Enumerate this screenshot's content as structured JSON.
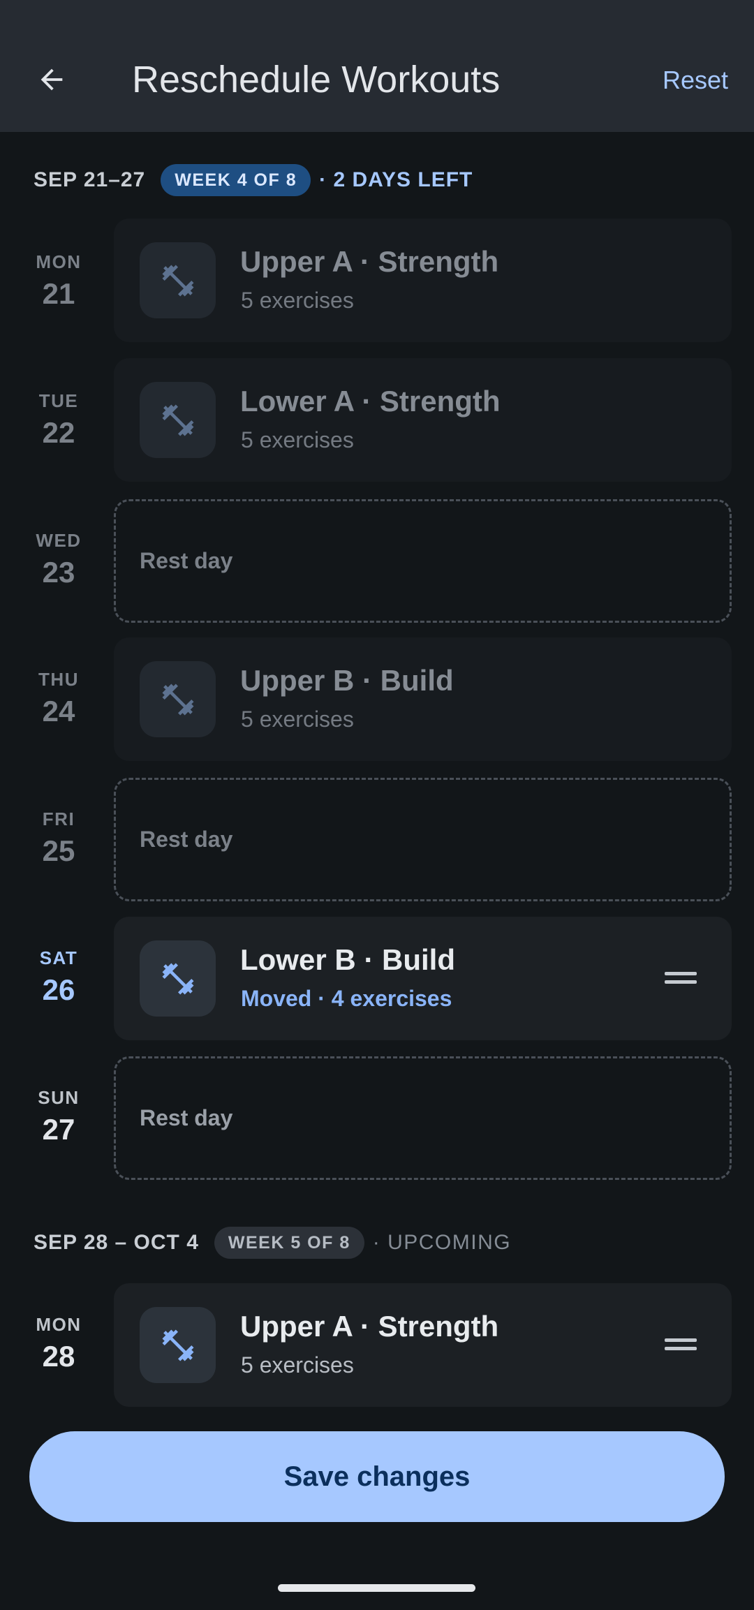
{
  "header": {
    "title": "Reschedule Workouts",
    "reset_label": "Reset",
    "back_icon": "arrow-left-icon"
  },
  "weeks": [
    {
      "range": "SEP 21–27",
      "pill": "WEEK 4 OF 8",
      "status": "· 2 DAYS LEFT",
      "days": [
        {
          "day": "MON",
          "date": "21",
          "kind": "workout",
          "title": "Upper A · Strength",
          "subtitle": "5 exercises"
        },
        {
          "day": "TUE",
          "date": "22",
          "kind": "workout",
          "title": "Lower A · Strength",
          "subtitle": "5 exercises"
        },
        {
          "day": "WED",
          "date": "23",
          "kind": "rest",
          "title": "Rest day"
        },
        {
          "day": "THU",
          "date": "24",
          "kind": "workout",
          "title": "Upper B · Build",
          "subtitle": "5 exercises"
        },
        {
          "day": "FRI",
          "date": "25",
          "kind": "rest",
          "title": "Rest day"
        },
        {
          "day": "SAT",
          "date": "26",
          "kind": "workout",
          "title": "Lower B · Build",
          "subtitle": "Moved · 4 exercises"
        },
        {
          "day": "SUN",
          "date": "27",
          "kind": "rest",
          "title": "Rest day"
        }
      ]
    },
    {
      "range": "SEP 28 – OCT 4",
      "pill": "WEEK 5 OF 8",
      "status": "· UPCOMING",
      "days": [
        {
          "day": "MON",
          "date": "28",
          "kind": "workout",
          "title": "Upper A · Strength",
          "subtitle": "5 exercises"
        }
      ]
    }
  ],
  "save_label": "Save changes",
  "icons": {
    "workout": "dumbbell-icon",
    "drag": "drag-handle-icon"
  },
  "colors": {
    "accent": "#a6c8ff",
    "background": "#121619",
    "appbar": "#262b32"
  }
}
